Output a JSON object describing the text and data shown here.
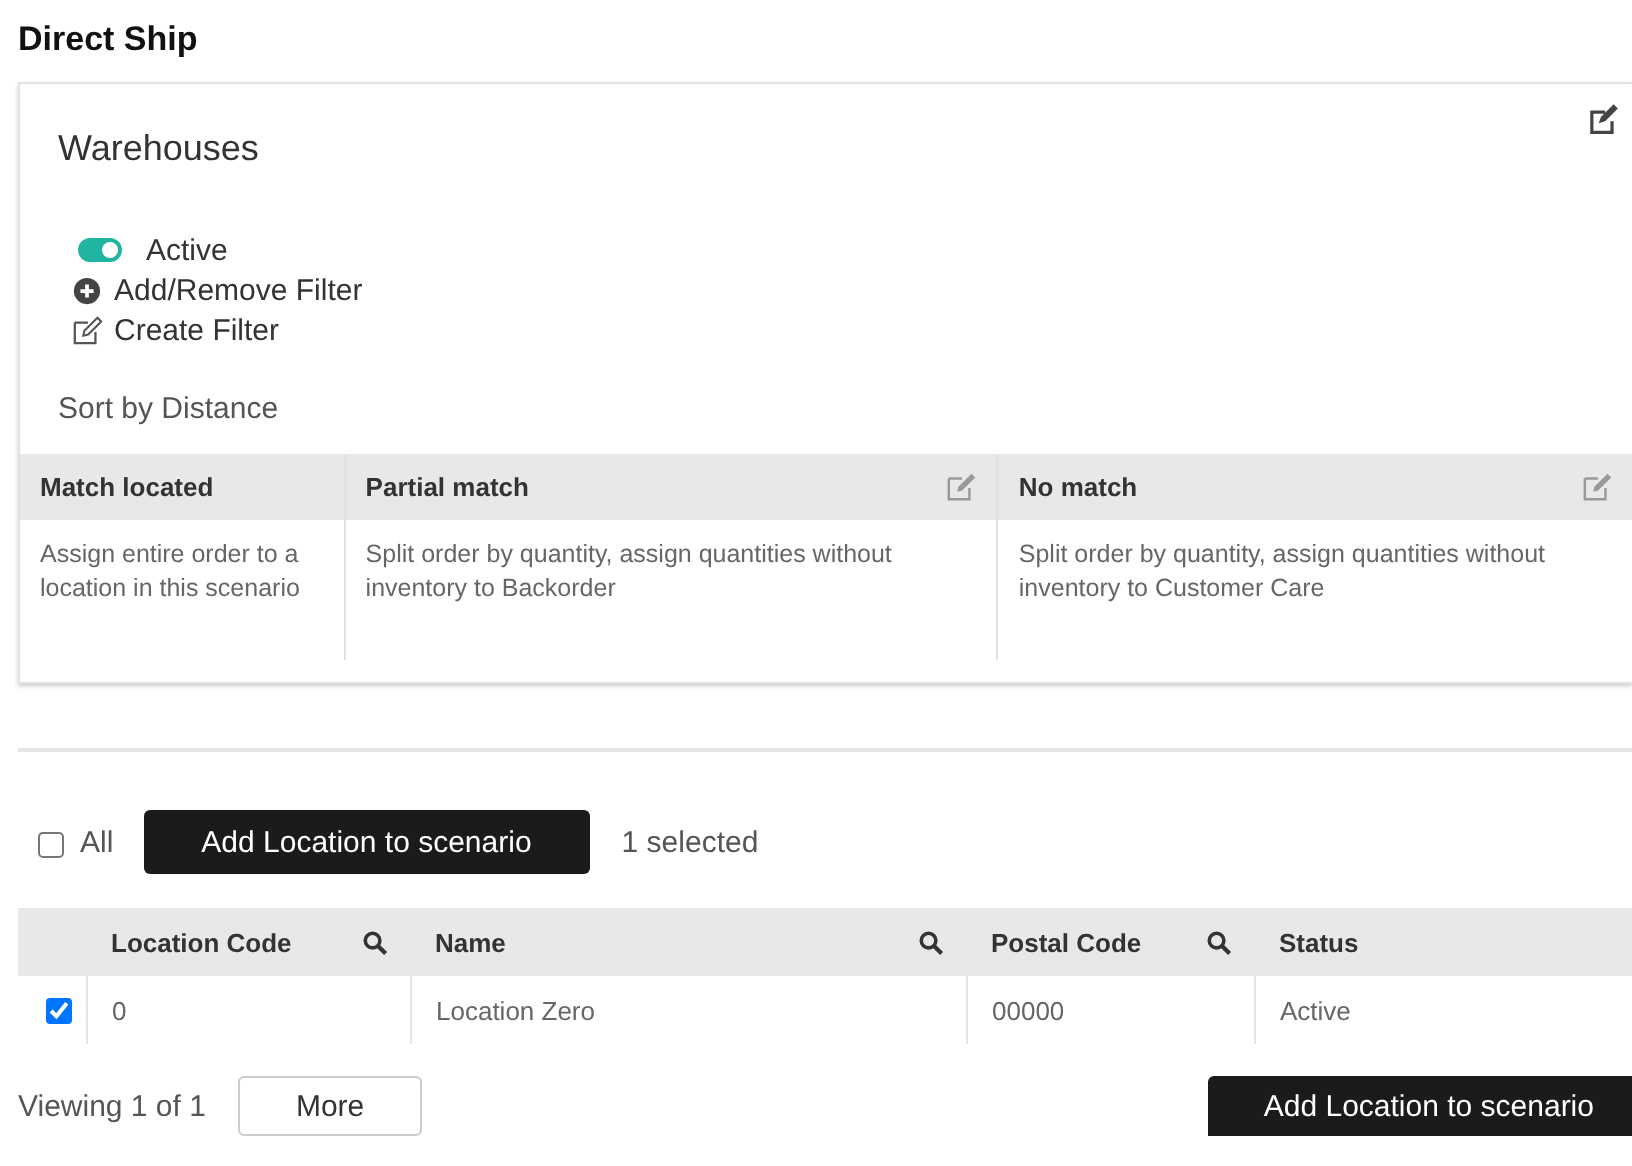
{
  "page": {
    "title": "Direct Ship"
  },
  "card": {
    "title": "Warehouses",
    "active": {
      "label": "Active",
      "on": true
    },
    "filter_links": [
      {
        "kind": "add",
        "label": "Add/Remove Filter"
      },
      {
        "kind": "edit",
        "label": "Create Filter"
      }
    ],
    "sort_label": "Sort by Distance",
    "rules": [
      {
        "heading": "Match located",
        "editable": false,
        "text": "Assign entire order to a location in this scenario"
      },
      {
        "heading": "Partial match",
        "editable": true,
        "text": "Split order by quantity, assign quantities without inventory to Backorder"
      },
      {
        "heading": "No match",
        "editable": true,
        "text": "Split order by quantity, assign quantities without inventory to Customer Care"
      }
    ]
  },
  "toolbar": {
    "all_label": "All",
    "all_checked": false,
    "button": "Add Location to scenario",
    "selection": "1 selected"
  },
  "table": {
    "columns": [
      {
        "label": "Location Code",
        "searchable": true
      },
      {
        "label": "Name",
        "searchable": true
      },
      {
        "label": "Postal Code",
        "searchable": true
      },
      {
        "label": "Status",
        "searchable": false
      }
    ],
    "rows": [
      {
        "selected": true,
        "cells": [
          "0",
          "Location Zero",
          "00000",
          "Active"
        ]
      }
    ]
  },
  "footer": {
    "viewing": "Viewing 1 of 1",
    "more": "More",
    "button": "Add Location to scenario"
  }
}
